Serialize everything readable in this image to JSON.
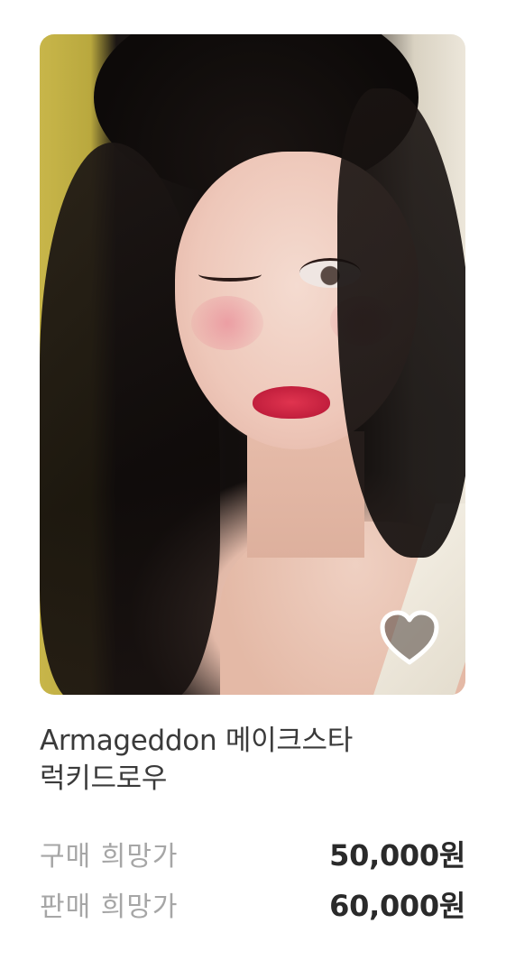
{
  "product": {
    "title_line1": "Armageddon 메이크스타",
    "title_line2": "럭키드로우",
    "image": "photocard-image",
    "favorite_icon": "heart-icon"
  },
  "prices": {
    "buy_label": "구매 희망가",
    "buy_value": "50,000원",
    "sell_label": "판매 희망가",
    "sell_value": "60,000원"
  },
  "colors": {
    "title": "#3a3a3a",
    "label": "#a6a6a6",
    "price": "#2a2a2a"
  }
}
